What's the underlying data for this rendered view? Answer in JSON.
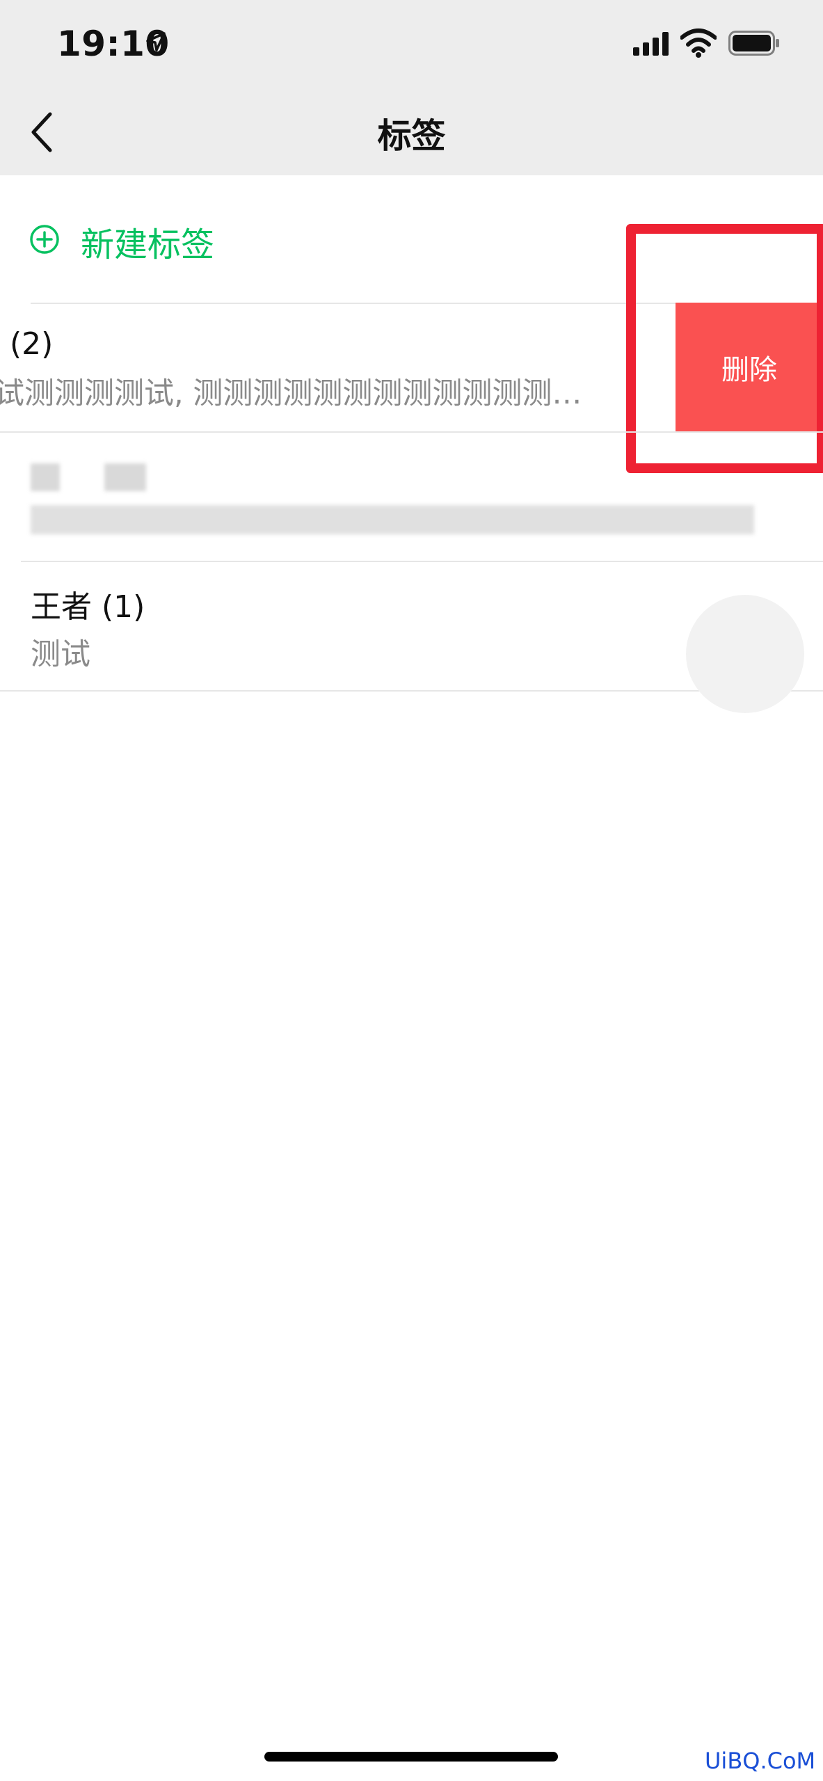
{
  "status_bar": {
    "time": "19:10",
    "icons": [
      "location-arrow-icon",
      "signal-icon",
      "wifi-icon",
      "battery-icon"
    ]
  },
  "nav": {
    "title": "标签",
    "back_icon": "chevron-left-icon"
  },
  "new_tag": {
    "label": "新建标签",
    "icon": "plus-circle-icon"
  },
  "tags": [
    {
      "title": "(2)",
      "subtitle": "试测测测测试, 测测测测测测测测测测测测…",
      "swiped": true
    },
    {
      "title": "",
      "subtitle": "",
      "blurred": true
    },
    {
      "title": "王者 (1)",
      "subtitle": "测试"
    }
  ],
  "swipe_action": {
    "delete_label": "删除"
  },
  "watermark": "UiBQ.CoM",
  "colors": {
    "accent_green": "#07c160",
    "delete_red": "#fa5151",
    "highlight_red": "#ee2233",
    "nav_background": "#ededed"
  }
}
